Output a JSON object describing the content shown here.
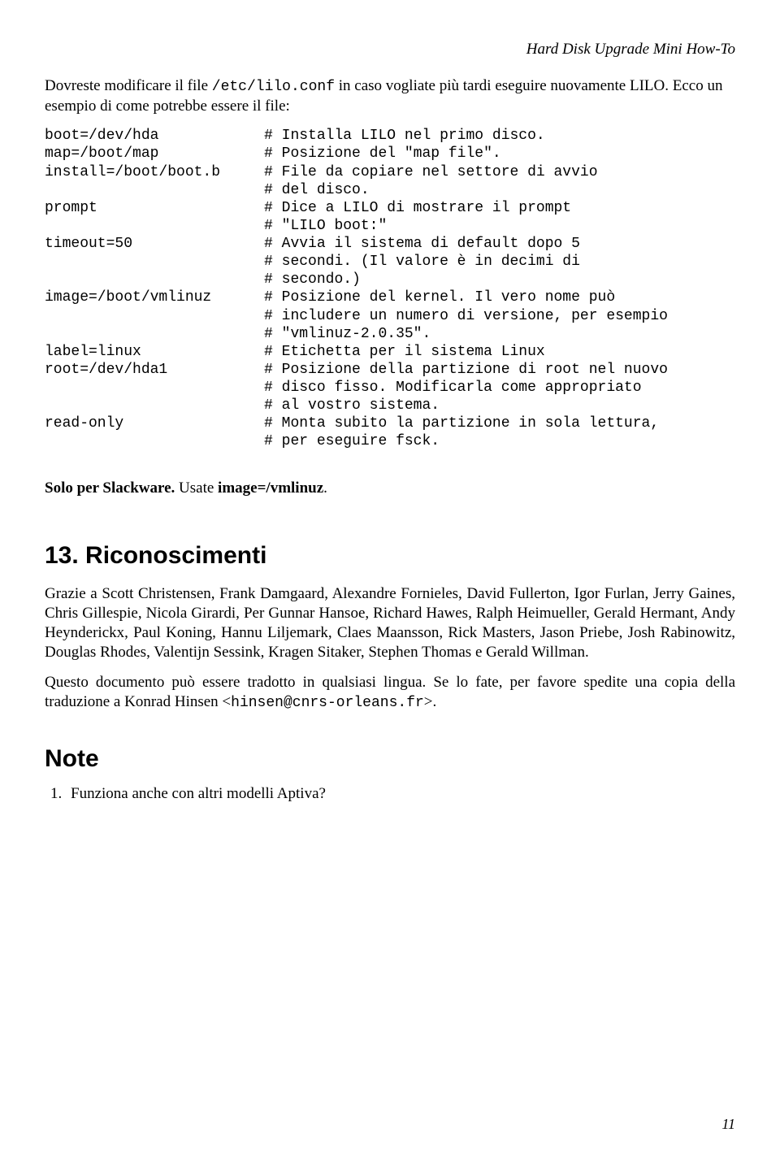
{
  "running_head": "Hard Disk Upgrade Mini How-To",
  "intro": {
    "part1": "Dovreste modificare il file ",
    "code": "/etc/lilo.conf",
    "part2": " in caso vogliate più tardi eseguire nuovamente LILO. Ecco un esempio di come potrebbe essere il file:"
  },
  "code_block": "boot=/dev/hda            # Installa LILO nel primo disco.\nmap=/boot/map            # Posizione del \"map file\".\ninstall=/boot/boot.b     # File da copiare nel settore di avvio\n                         # del disco.\nprompt                   # Dice a LILO di mostrare il prompt\n                         # \"LILO boot:\"\ntimeout=50               # Avvia il sistema di default dopo 5\n                         # secondi. (Il valore è in decimi di\n                         # secondo.)\nimage=/boot/vmlinuz      # Posizione del kernel. Il vero nome può\n                         # includere un numero di versione, per esempio\n                         # \"vmlinuz-2.0.35\".\nlabel=linux              # Etichetta per il sistema Linux\nroot=/dev/hda1           # Posizione della partizione di root nel nuovo\n                         # disco fisso. Modificarla come appropriato\n                         # al vostro sistema.\nread-only                # Monta subito la partizione in sola lettura,\n                         # per eseguire fsck.",
  "slackware_note": {
    "bold1": "Solo per Slackware.",
    "mid": " Usate ",
    "bold2": "image=/vmlinuz",
    "tail": "."
  },
  "section13": {
    "heading": "13. Riconoscimenti",
    "p1": "Grazie a Scott Christensen, Frank Damgaard, Alexandre Fornieles, David Fullerton, Igor Furlan, Jerry Gaines, Chris Gillespie, Nicola Girardi, Per Gunnar Hansoe, Richard Hawes, Ralph Heimueller, Gerald Hermant, Andy Heynderickx, Paul Koning, Hannu Liljemark, Claes Maansson, Rick Masters, Jason Priebe, Josh Rabinowitz, Douglas Rhodes, Valentijn Sessink, Kragen Sitaker, Stephen Thomas e Gerald Willman.",
    "p2_part1": "Questo documento può essere tradotto in qualsiasi lingua. Se lo fate, per favore spedite una copia della traduzione a Konrad Hinsen <",
    "p2_code": "hinsen@cnrs-orleans.fr",
    "p2_part2": ">."
  },
  "notes": {
    "heading": "Note",
    "item1": "Funziona anche con altri modelli Aptiva?"
  },
  "page_number": "11"
}
